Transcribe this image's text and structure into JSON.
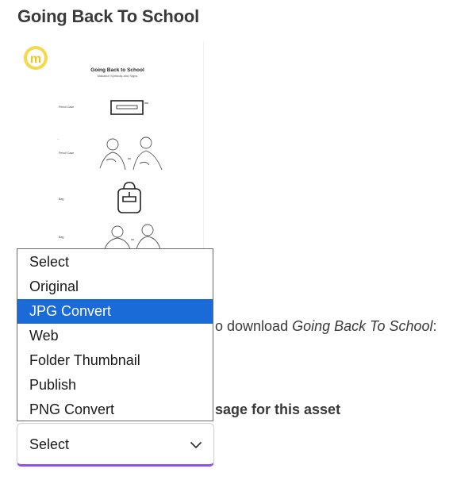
{
  "page": {
    "title": "Going Back To School"
  },
  "thumbnail": {
    "logo_letter": "m",
    "doc_title": "Going Back to School",
    "doc_subtitle": "Makaton Symbols and Signs",
    "row_labels": [
      "Pencil Case",
      "Pencil Case",
      "Bag",
      "Bag"
    ]
  },
  "download": {
    "text_before": "o download ",
    "asset_name": "Going Back To School",
    "text_after": ":"
  },
  "usage": {
    "heading_fragment": "sage for this asset"
  },
  "dropdown": {
    "options": [
      "Select",
      "Original",
      "JPG Convert",
      "Web",
      "Folder Thumbnail",
      "Publish",
      "PNG Convert"
    ],
    "highlighted": "JPG Convert",
    "current_value": "Select"
  },
  "colors": {
    "highlight": "#1a6ad8",
    "focus_border": "#8a55e8",
    "logo": "#f5d94a"
  }
}
